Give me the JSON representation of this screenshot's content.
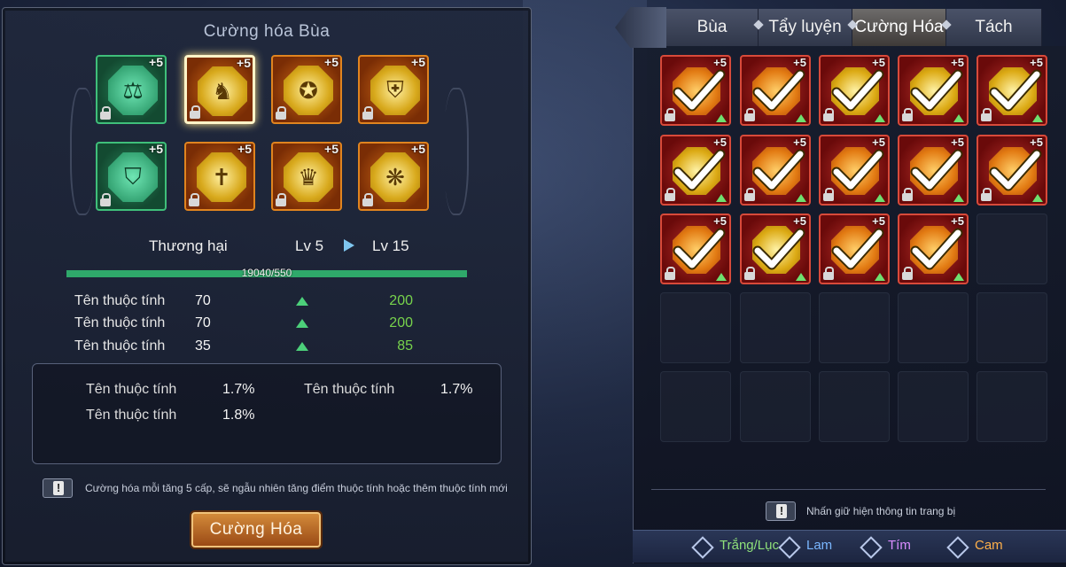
{
  "left": {
    "title": "Cường hóa Bùa",
    "charms": [
      {
        "color": "green",
        "plus": "+5",
        "symbol": "⚖",
        "selected": false
      },
      {
        "color": "gold",
        "plus": "+5",
        "symbol": "♞",
        "selected": true
      },
      {
        "color": "gold",
        "plus": "+5",
        "symbol": "✪",
        "selected": false
      },
      {
        "color": "gold",
        "plus": "+5",
        "symbol": "⛨",
        "selected": false
      },
      {
        "color": "green",
        "plus": "+5",
        "symbol": "⛉",
        "selected": false
      },
      {
        "color": "gold",
        "plus": "+5",
        "symbol": "✝",
        "selected": false
      },
      {
        "color": "gold",
        "plus": "+5",
        "symbol": "♛",
        "selected": false
      },
      {
        "color": "gold",
        "plus": "+5",
        "symbol": "❋",
        "selected": false
      }
    ],
    "attr_name": "Thương hại",
    "level_from": "Lv 5",
    "level_to": "Lv 15",
    "progress_text": "19040/550",
    "progress_fraction": 1.0,
    "stats": [
      {
        "name": "Tên thuộc tính",
        "current": "70",
        "next": "200"
      },
      {
        "name": "Tên thuộc tính",
        "current": "70",
        "next": "200"
      },
      {
        "name": "Tên thuộc tính",
        "current": "35",
        "next": "85"
      }
    ],
    "sub_stats": [
      {
        "name": "Tên thuộc tính",
        "value": "1.7%"
      },
      {
        "name": "Tên thuộc tính",
        "value": "1.7%"
      },
      {
        "name": "Tên thuộc tính",
        "value": "1.8%"
      }
    ],
    "tip": "Cường hóa mỗi tăng 5  cấp, sẽ ngẫu nhiên tăng điểm thuộc tính hoặc thêm thuộc tính mới",
    "tip_icon": "!",
    "enhance_button": "Cường Hóa"
  },
  "tabs": [
    "Bùa",
    "Tẩy luyện",
    "Cường Hóa",
    "Tách"
  ],
  "active_tab": 2,
  "inventory": {
    "items": [
      {
        "gem": "orange",
        "plus": "+5"
      },
      {
        "gem": "orange",
        "plus": "+5"
      },
      {
        "gem": "gold",
        "plus": "+5"
      },
      {
        "gem": "gold",
        "plus": "+5"
      },
      {
        "gem": "gold",
        "plus": "+5"
      },
      {
        "gem": "gold",
        "plus": "+5"
      },
      {
        "gem": "orange",
        "plus": "+5"
      },
      {
        "gem": "orange",
        "plus": "+5"
      },
      {
        "gem": "orange",
        "plus": "+5"
      },
      {
        "gem": "orange",
        "plus": "+5"
      },
      {
        "gem": "orange",
        "plus": "+5"
      },
      {
        "gem": "gold",
        "plus": "+5"
      },
      {
        "gem": "orange",
        "plus": "+5"
      },
      {
        "gem": "orange",
        "plus": "+5"
      }
    ],
    "total_slots": 25
  },
  "hint": "Nhấn giữ hiện thông tin trang bị",
  "hint_icon": "!",
  "filters": [
    {
      "label": "Trắng/Lục",
      "color": "#8fe07a"
    },
    {
      "label": "Lam",
      "color": "#7ab6ff"
    },
    {
      "label": "Tím",
      "color": "#d98cff"
    },
    {
      "label": "Cam",
      "color": "#ffb04a"
    }
  ]
}
